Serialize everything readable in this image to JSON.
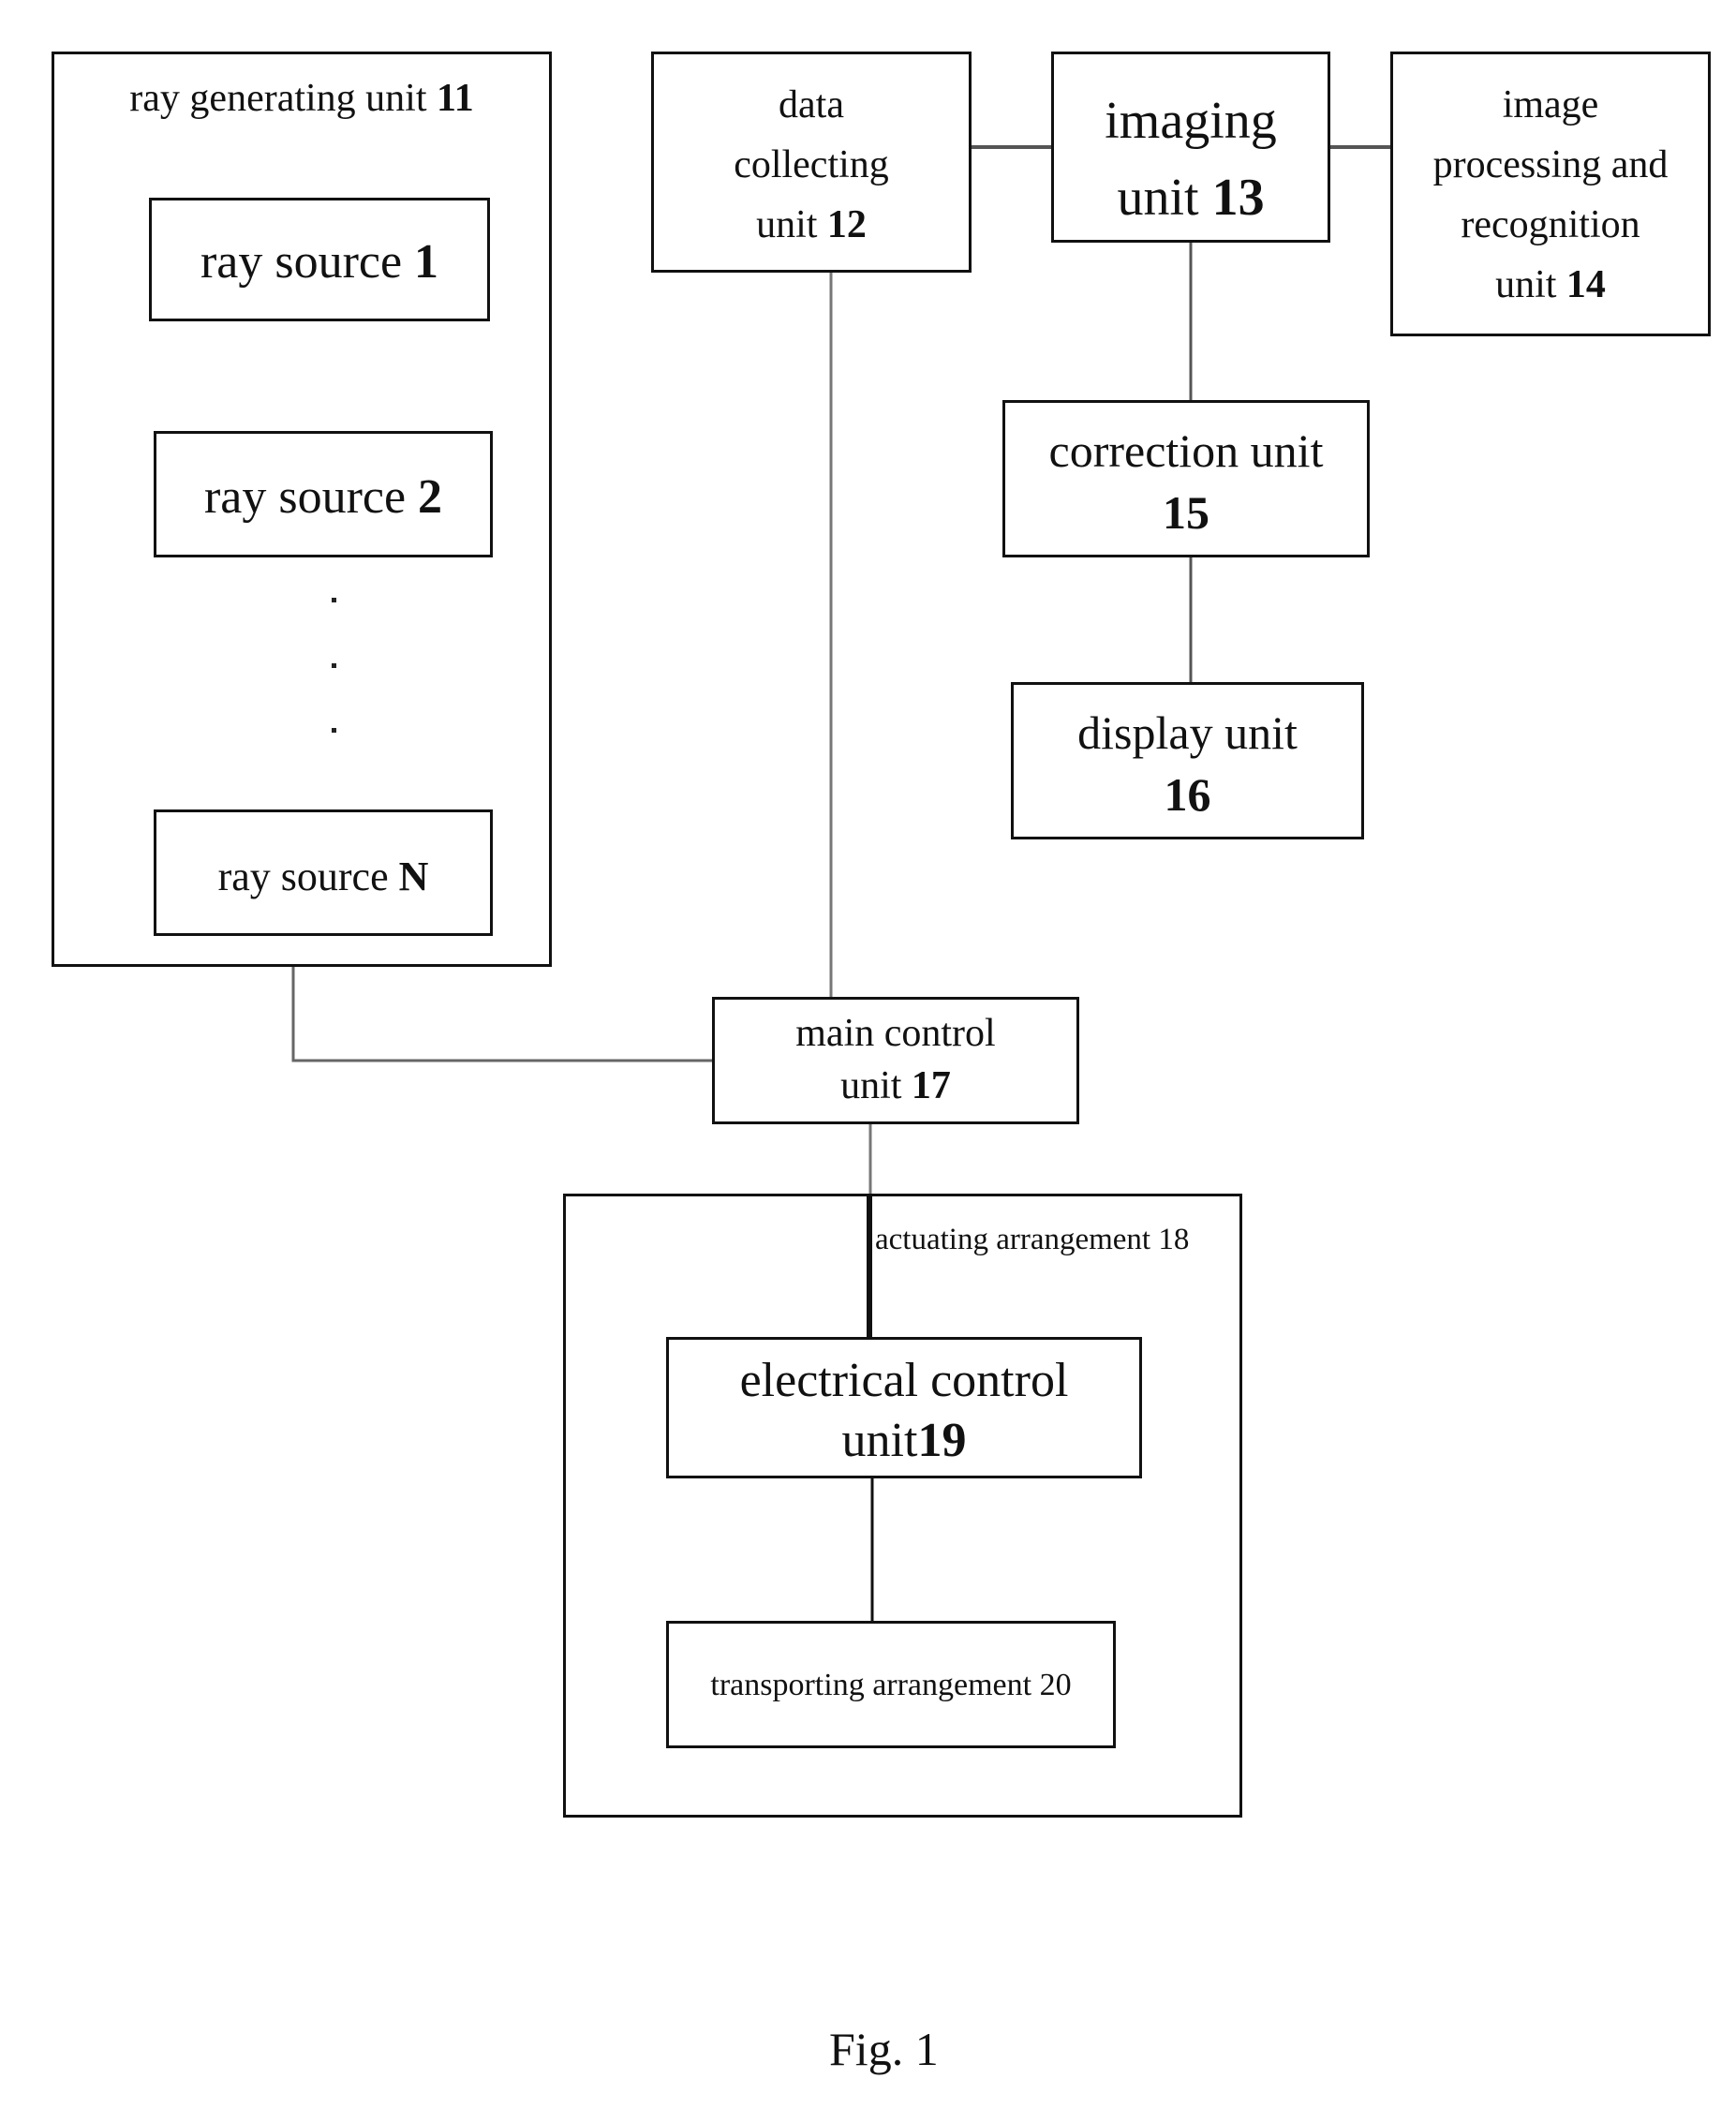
{
  "figure": {
    "caption": "Fig. 1",
    "units": {
      "ray_generating": {
        "text": "ray generating unit ",
        "num": "11"
      },
      "ray_source_1": {
        "text": "ray source ",
        "num": "1"
      },
      "ray_source_2": {
        "text": "ray source ",
        "num": "2"
      },
      "ray_source_n": {
        "text": "ray source ",
        "num": "N"
      },
      "data_collecting": {
        "line1": "data",
        "line2": "collecting",
        "line3": "unit ",
        "num": "12"
      },
      "imaging": {
        "line1": "imaging",
        "line2": "unit ",
        "num": "13"
      },
      "image_processing": {
        "line1": "image",
        "line2": "processing and",
        "line3": "recognition",
        "line4": "unit ",
        "num": "14"
      },
      "correction": {
        "line1": "correction unit",
        "num": "15"
      },
      "display": {
        "line1": "display unit",
        "num": "16"
      },
      "main_control": {
        "line1": "main control",
        "line2": "unit ",
        "num": "17"
      },
      "actuating": {
        "text": "actuating arrangement 18"
      },
      "electrical_control": {
        "line1": "electrical control",
        "line2": "unit",
        "num": "19"
      },
      "transporting": {
        "text": "transporting arrangement 20"
      }
    }
  }
}
